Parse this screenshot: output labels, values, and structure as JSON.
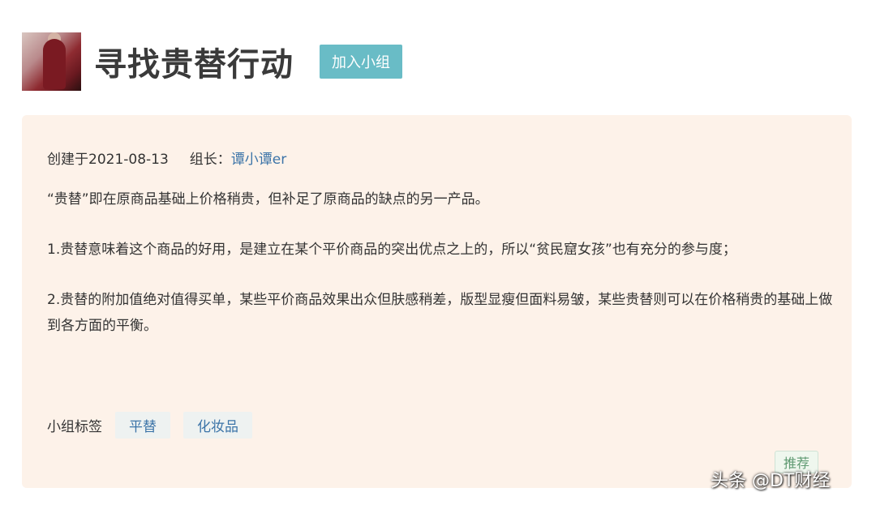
{
  "group": {
    "title": "寻找贵替行动",
    "join_label": "加入小组"
  },
  "meta": {
    "created": "创建于2021-08-13",
    "leader_label": "组长：",
    "leader_name": "谭小谭er"
  },
  "description": {
    "p1": "“贵替”即在原商品基础上价格稍贵，但补足了原商品的缺点的另一产品。",
    "p2": "1.贵替意味着这个商品的好用，是建立在某个平价商品的突出优点之上的，所以“贫民窟女孩”也有充分的参与度；",
    "p3": "2.贵替的附加值绝对值得买单，某些平价商品效果出众但肤感稍差，版型显瘦但面料易皱，某些贵替则可以在价格稍贵的基础上做到各方面的平衡。"
  },
  "tags": {
    "label": "小组标签",
    "items": [
      "平替",
      "化妆品"
    ]
  },
  "recommend_label": "推荐",
  "watermark": "头条 @DT财经",
  "colors": {
    "panel_bg": "#fdf2e9",
    "join_button": "#69bcc6",
    "link": "#3c74a8"
  }
}
